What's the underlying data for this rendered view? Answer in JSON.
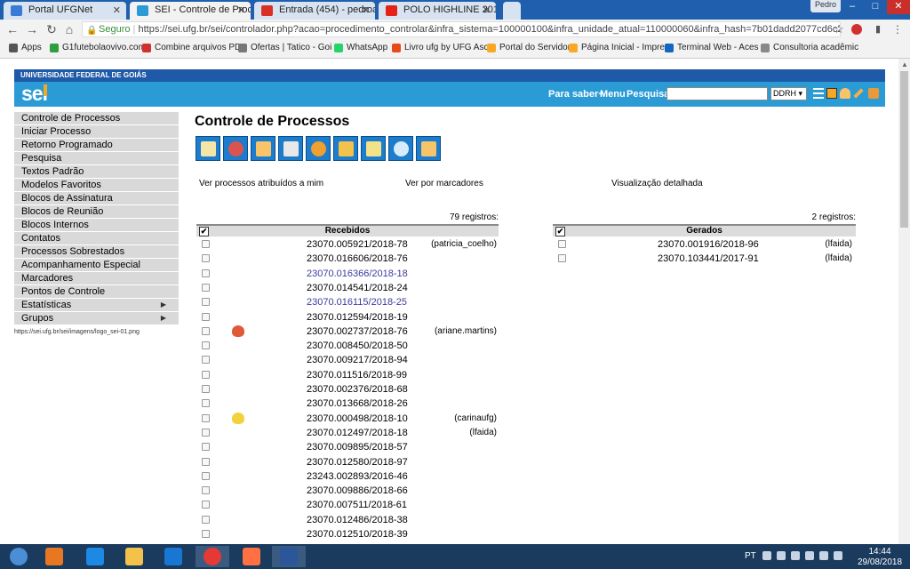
{
  "browser": {
    "tabs": [
      {
        "title": "Portal UFGNet",
        "color": "#3a7bd5"
      },
      {
        "title": "SEI - Controle de Process",
        "color": "#2b9bd6",
        "active": true
      },
      {
        "title": "Entrada (454) - pedroalb",
        "color": "#d93025"
      },
      {
        "title": "POLO HIGHLINE 2019",
        "color": "#e62117"
      }
    ],
    "window_user": "Pedro",
    "secure_label": "Seguro",
    "url": "https://sei.ufg.br/sei/controlador.php?acao=procedimento_controlar&infra_sistema=100000100&infra_unidade_atual=110000060&infra_hash=7b01dadd2077cd6c24cd04ff3e7...",
    "bookmarks": [
      {
        "label": "Apps",
        "color": "#555"
      },
      {
        "label": "G1futebolaovivo.com",
        "color": "#2e9e3e"
      },
      {
        "label": "Combine arquivos PD",
        "color": "#d32f2f"
      },
      {
        "label": "Ofertas | Tatico - Goi",
        "color": "#777"
      },
      {
        "label": "WhatsApp",
        "color": "#25d366"
      },
      {
        "label": "Livro ufg by UFG Asc",
        "color": "#e64a19"
      },
      {
        "label": "Portal do Servidor",
        "color": "#f9a825"
      },
      {
        "label": "Página Inicial - Impre",
        "color": "#f9a825"
      },
      {
        "label": "Terminal Web - Aces",
        "color": "#1565c0"
      },
      {
        "label": "Consultoria acadêmic",
        "color": "#888"
      }
    ]
  },
  "sei": {
    "org": "UNIVERSIDADE FEDERAL DE GOIÁS",
    "logo": "sei",
    "links": {
      "saber": "Para saber+",
      "menu": "Menu",
      "pesquisa": "Pesquisa"
    },
    "search_value": "",
    "unit": "DDRH"
  },
  "sidebar": [
    {
      "label": "Controle de Processos"
    },
    {
      "label": "Iniciar Processo"
    },
    {
      "label": "Retorno Programado"
    },
    {
      "label": "Pesquisa"
    },
    {
      "label": "Textos Padrão"
    },
    {
      "label": "Modelos Favoritos"
    },
    {
      "label": "Blocos de Assinatura"
    },
    {
      "label": "Blocos de Reunião"
    },
    {
      "label": "Blocos Internos"
    },
    {
      "label": "Contatos"
    },
    {
      "label": "Processos Sobrestados"
    },
    {
      "label": "Acompanhamento Especial"
    },
    {
      "label": "Marcadores"
    },
    {
      "label": "Pontos de Controle"
    },
    {
      "label": "Estatísticas",
      "submenu": true
    },
    {
      "label": "Grupos",
      "submenu": true
    }
  ],
  "status_url": "https://sei.ufg.br/sei/imagens/logo_sei-01.png",
  "main": {
    "title": "Controle de Processos",
    "toolbar_icons": [
      "send-process-icon",
      "attach-icon",
      "assign-icon",
      "print-icon",
      "suspend-icon",
      "close-process-icon",
      "annotation-icon",
      "new-document-icon",
      "marker-icon"
    ],
    "views": {
      "assigned": "Ver processos atribuídos a mim",
      "markers": "Ver por marcadores",
      "detailed": "Visualização detalhada"
    },
    "received": {
      "count": "79 registros:",
      "header": "Recebidos",
      "rows": [
        {
          "num": "23070.005921/2018-78",
          "user": "(patricia_coelho)"
        },
        {
          "num": "23070.016606/2018-76"
        },
        {
          "num": "23070.016366/2018-18",
          "visited": true
        },
        {
          "num": "23070.014541/2018-24"
        },
        {
          "num": "23070.016115/2018-25",
          "visited": true
        },
        {
          "num": "23070.012594/2018-19"
        },
        {
          "num": "23070.002737/2018-76",
          "user": "(ariane.martins)",
          "flag": "#e05a3a"
        },
        {
          "num": "23070.008450/2018-50"
        },
        {
          "num": "23070.009217/2018-94"
        },
        {
          "num": "23070.011516/2018-99"
        },
        {
          "num": "23070.002376/2018-68"
        },
        {
          "num": "23070.013668/2018-26"
        },
        {
          "num": "23070.000498/2018-10",
          "user": "(carinaufg)",
          "flag": "#f2d23c"
        },
        {
          "num": "23070.012497/2018-18",
          "user": "(lfaida)"
        },
        {
          "num": "23070.009895/2018-57"
        },
        {
          "num": "23070.012580/2018-97"
        },
        {
          "num": "23243.002893/2016-46"
        },
        {
          "num": "23070.009886/2018-66"
        },
        {
          "num": "23070.007511/2018-61"
        },
        {
          "num": "23070.012486/2018-38"
        },
        {
          "num": "23070.012510/2018-39"
        }
      ]
    },
    "generated": {
      "count": "2 registros:",
      "header": "Gerados",
      "rows": [
        {
          "num": "23070.001916/2018-96",
          "user": "(lfaida)"
        },
        {
          "num": "23070.103441/2017-91",
          "user": "(lfaida)"
        }
      ]
    }
  },
  "taskbar": {
    "apps": [
      {
        "name": "start",
        "color": "#4a8fd6"
      },
      {
        "name": "media-player",
        "color": "#e87722"
      },
      {
        "name": "internet-explorer",
        "color": "#1e88e5"
      },
      {
        "name": "file-explorer",
        "color": "#f3c24a"
      },
      {
        "name": "outlook",
        "color": "#1976d2"
      },
      {
        "name": "chrome",
        "color": "#e53935",
        "active": true
      },
      {
        "name": "firefox",
        "color": "#ff7043"
      },
      {
        "name": "word",
        "color": "#2b579a",
        "active": true
      }
    ],
    "lang": "PT",
    "time": "14:44",
    "date": "29/08/2018"
  }
}
